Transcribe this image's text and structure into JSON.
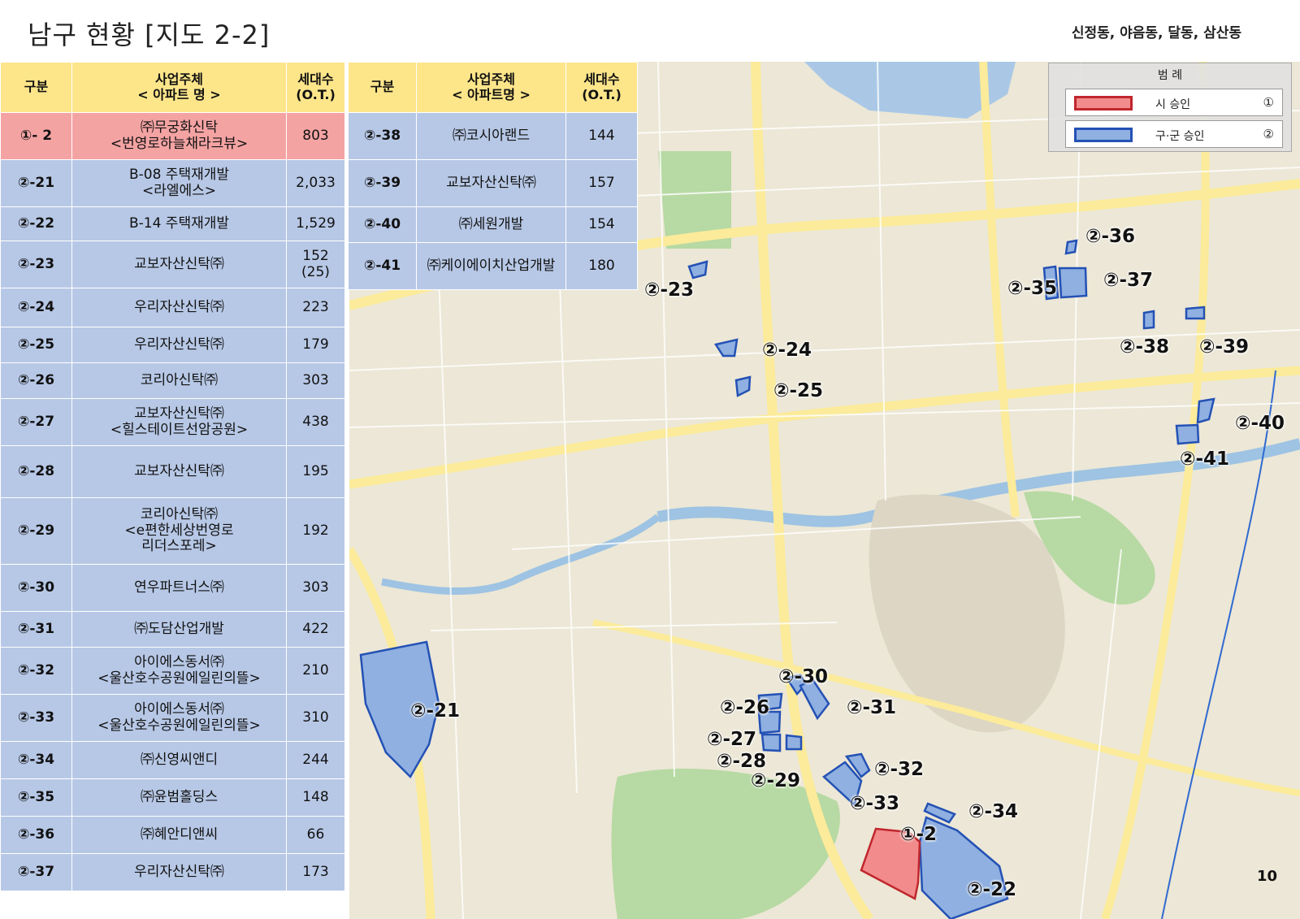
{
  "title": "남구 현황 [지도 2-2]",
  "subtitle": "신정동,  야음동,  달동,  삼산동",
  "page_number": "10",
  "table_headers": {
    "division": "구분",
    "developer": "사업주체\n< 아파트 명 >",
    "developer_right": "사업주체\n< 아파트명 >",
    "units": "세대수\n(O.T.)"
  },
  "left_rows": [
    {
      "code": "①- 2",
      "name": "㈜무궁화신탁\n<번영로하늘채라크뷰>",
      "units": "803",
      "status": "city"
    },
    {
      "code": "②-21",
      "name": "B-08 주택재개발\n<라엘에스>",
      "units": "2,033",
      "status": "district"
    },
    {
      "code": "②-22",
      "name": "B-14 주택재개발",
      "units": "1,529",
      "status": "district"
    },
    {
      "code": "②-23",
      "name": "교보자산신탁㈜",
      "units": "152\n(25)",
      "status": "district"
    },
    {
      "code": "②-24",
      "name": "우리자산신탁㈜",
      "units": "223",
      "status": "district"
    },
    {
      "code": "②-25",
      "name": "우리자산신탁㈜",
      "units": "179",
      "status": "district"
    },
    {
      "code": "②-26",
      "name": "코리아신탁㈜",
      "units": "303",
      "status": "district"
    },
    {
      "code": "②-27",
      "name": "교보자산신탁㈜\n<힐스테이트선암공원>",
      "units": "438",
      "status": "district"
    },
    {
      "code": "②-28",
      "name": "교보자산신탁㈜",
      "units": "195",
      "status": "district"
    },
    {
      "code": "②-29",
      "name": "코리아신탁㈜\n<e편한세상번영로\n리더스포레>",
      "units": "192",
      "status": "district"
    },
    {
      "code": "②-30",
      "name": "연우파트너스㈜",
      "units": "303",
      "status": "district"
    },
    {
      "code": "②-31",
      "name": "㈜도담산업개발",
      "units": "422",
      "status": "district"
    },
    {
      "code": "②-32",
      "name": "아이에스동서㈜\n<울산호수공원에일린의뜰>",
      "units": "210",
      "status": "district"
    },
    {
      "code": "②-33",
      "name": "아이에스동서㈜\n<울산호수공원에일린의뜰>",
      "units": "310",
      "status": "district"
    },
    {
      "code": "②-34",
      "name": "㈜신영씨앤디",
      "units": "244",
      "status": "district"
    },
    {
      "code": "②-35",
      "name": "㈜윤범홀딩스",
      "units": "148",
      "status": "district"
    },
    {
      "code": "②-36",
      "name": "㈜혜안디앤씨",
      "units": "66",
      "status": "district"
    },
    {
      "code": "②-37",
      "name": "우리자산신탁㈜",
      "units": "173",
      "status": "district"
    }
  ],
  "right_rows": [
    {
      "code": "②-38",
      "name": "㈜코시아랜드",
      "units": "144",
      "status": "district"
    },
    {
      "code": "②-39",
      "name": "교보자산신탁㈜",
      "units": "157",
      "status": "district"
    },
    {
      "code": "②-40",
      "name": "㈜세원개발",
      "units": "154",
      "status": "district"
    },
    {
      "code": "②-41",
      "name": "㈜케이에이치산업개발",
      "units": "180",
      "status": "district"
    }
  ],
  "legend": {
    "title": "범 례",
    "items": [
      {
        "label": "시 승인",
        "mark": "①",
        "fill": "#f28b8b",
        "stroke": "#c0262d"
      },
      {
        "label": "구·군 승인",
        "mark": "②",
        "fill": "#8fb0e0",
        "stroke": "#2451b5"
      }
    ]
  },
  "map_labels": [
    {
      "id": "label-2-21",
      "text": "②-21"
    },
    {
      "id": "label-2-22",
      "text": "②-22"
    },
    {
      "id": "label-2-23",
      "text": "②-23"
    },
    {
      "id": "label-2-24",
      "text": "②-24"
    },
    {
      "id": "label-2-25",
      "text": "②-25"
    },
    {
      "id": "label-2-26",
      "text": "②-26"
    },
    {
      "id": "label-2-27",
      "text": "②-27"
    },
    {
      "id": "label-2-28",
      "text": "②-28"
    },
    {
      "id": "label-2-29",
      "text": "②-29"
    },
    {
      "id": "label-2-30",
      "text": "②-30"
    },
    {
      "id": "label-2-31",
      "text": "②-31"
    },
    {
      "id": "label-2-32",
      "text": "②-32"
    },
    {
      "id": "label-2-33",
      "text": "②-33"
    },
    {
      "id": "label-2-34",
      "text": "②-34"
    },
    {
      "id": "label-2-35",
      "text": "②-35"
    },
    {
      "id": "label-2-36",
      "text": "②-36"
    },
    {
      "id": "label-2-37",
      "text": "②-37"
    },
    {
      "id": "label-2-38",
      "text": "②-38"
    },
    {
      "id": "label-2-39",
      "text": "②-39"
    },
    {
      "id": "label-2-40",
      "text": "②-40"
    },
    {
      "id": "label-2-41",
      "text": "②-41"
    },
    {
      "id": "label-1-2",
      "text": "①-2"
    }
  ],
  "colors": {
    "header": "#fde58a",
    "city_row": "#f4a3a3",
    "district_row": "#b7c8e6",
    "city_polygon": "#f28b8b",
    "district_polygon": "#8fb0e0"
  }
}
